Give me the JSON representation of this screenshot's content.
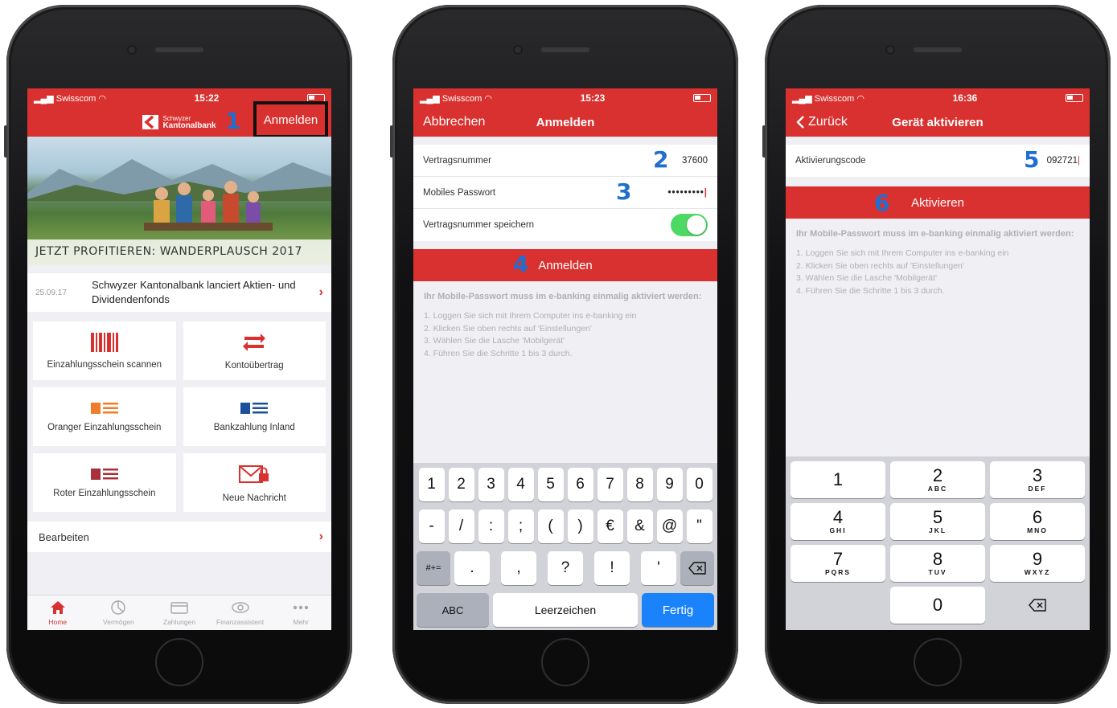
{
  "phone1": {
    "status": {
      "carrier": "Swisscom",
      "time": "15:22"
    },
    "brand": {
      "line1": "Schwyzer",
      "line2": "Kantonalbank"
    },
    "login_label": "Anmelden",
    "marker": "1",
    "hero_caption": "JETZT PROFITIEREN: WANDERPLAUSCH 2017",
    "news": {
      "date": "25.09.17",
      "text": "Schwyzer Kantonalbank lanciert Aktien- und Dividendenfonds"
    },
    "tiles": [
      {
        "label": "Einzahlungsschein scannen",
        "icon": "barcode-icon"
      },
      {
        "label": "Kontoübertrag",
        "icon": "transfer-icon"
      },
      {
        "label": "Oranger Einzahlungsschein",
        "icon": "orange-slip-icon"
      },
      {
        "label": "Bankzahlung Inland",
        "icon": "blue-slip-icon"
      },
      {
        "label": "Roter Einzahlungsschein",
        "icon": "red-slip-icon"
      },
      {
        "label": "Neue Nachricht",
        "icon": "envelope-lock-icon"
      }
    ],
    "edit_label": "Bearbeiten",
    "tabs": [
      "Home",
      "Vermögen",
      "Zahlungen",
      "Finanzassistent",
      "Mehr"
    ]
  },
  "phone2": {
    "status": {
      "carrier": "Swisscom",
      "time": "15:23"
    },
    "cancel_label": "Abbrechen",
    "title": "Anmelden",
    "fields": [
      {
        "label": "Vertragsnummer",
        "value": "37600",
        "marker": "2"
      },
      {
        "label": "Mobiles Passwort",
        "value": "•••••••••",
        "marker": "3"
      },
      {
        "label": "Vertragsnummer speichern"
      }
    ],
    "button_label": "Anmelden",
    "button_marker": "4",
    "info_head": "Ihr Mobile-Passwort muss im e-banking einmalig aktiviert werden:",
    "steps": [
      "1. Loggen Sie sich mit Ihrem Computer ins e-banking ein",
      "2. Klicken Sie oben rechts auf 'Einstellungen'",
      "3. Wählen Sie die Lasche 'Mobilgerät'",
      "4. Führen Sie die Schritte 1 bis 3 durch."
    ],
    "keyboard": {
      "row1": [
        "1",
        "2",
        "3",
        "4",
        "5",
        "6",
        "7",
        "8",
        "9",
        "0"
      ],
      "row2": [
        "-",
        "/",
        ":",
        ";",
        "(",
        ")",
        "€",
        "&",
        "@",
        "\""
      ],
      "row3": [
        ".",
        ",",
        "?",
        "!",
        "'"
      ],
      "symbols_key": "#+=",
      "abc_key": "ABC",
      "space_key": "Leerzeichen",
      "done_key": "Fertig"
    }
  },
  "phone3": {
    "status": {
      "carrier": "Swisscom",
      "time": "16:36"
    },
    "back_label": "Zurück",
    "title": "Gerät aktivieren",
    "field": {
      "label": "Aktivierungscode",
      "value": "092721",
      "marker": "5"
    },
    "button_label": "Aktivieren",
    "button_marker": "6",
    "info_head": "Ihr Mobile-Passwort muss im e-banking einmalig aktiviert werden:",
    "steps": [
      "1. Loggen Sie sich mit Ihrem Computer ins e-banking ein",
      "2. Klicken Sie oben rechts auf 'Einstellungen'",
      "3. Wählen Sie die Lasche 'Mobilgerät'",
      "4. Führen Sie die Schritte 1 bis 3 durch."
    ],
    "numpad": [
      {
        "d": "1",
        "l": ""
      },
      {
        "d": "2",
        "l": "ABC"
      },
      {
        "d": "3",
        "l": "DEF"
      },
      {
        "d": "4",
        "l": "GHI"
      },
      {
        "d": "5",
        "l": "JKL"
      },
      {
        "d": "6",
        "l": "MNO"
      },
      {
        "d": "7",
        "l": "PQRS"
      },
      {
        "d": "8",
        "l": "TUV"
      },
      {
        "d": "9",
        "l": "WXYZ"
      },
      {
        "d": "0",
        "l": ""
      }
    ]
  }
}
